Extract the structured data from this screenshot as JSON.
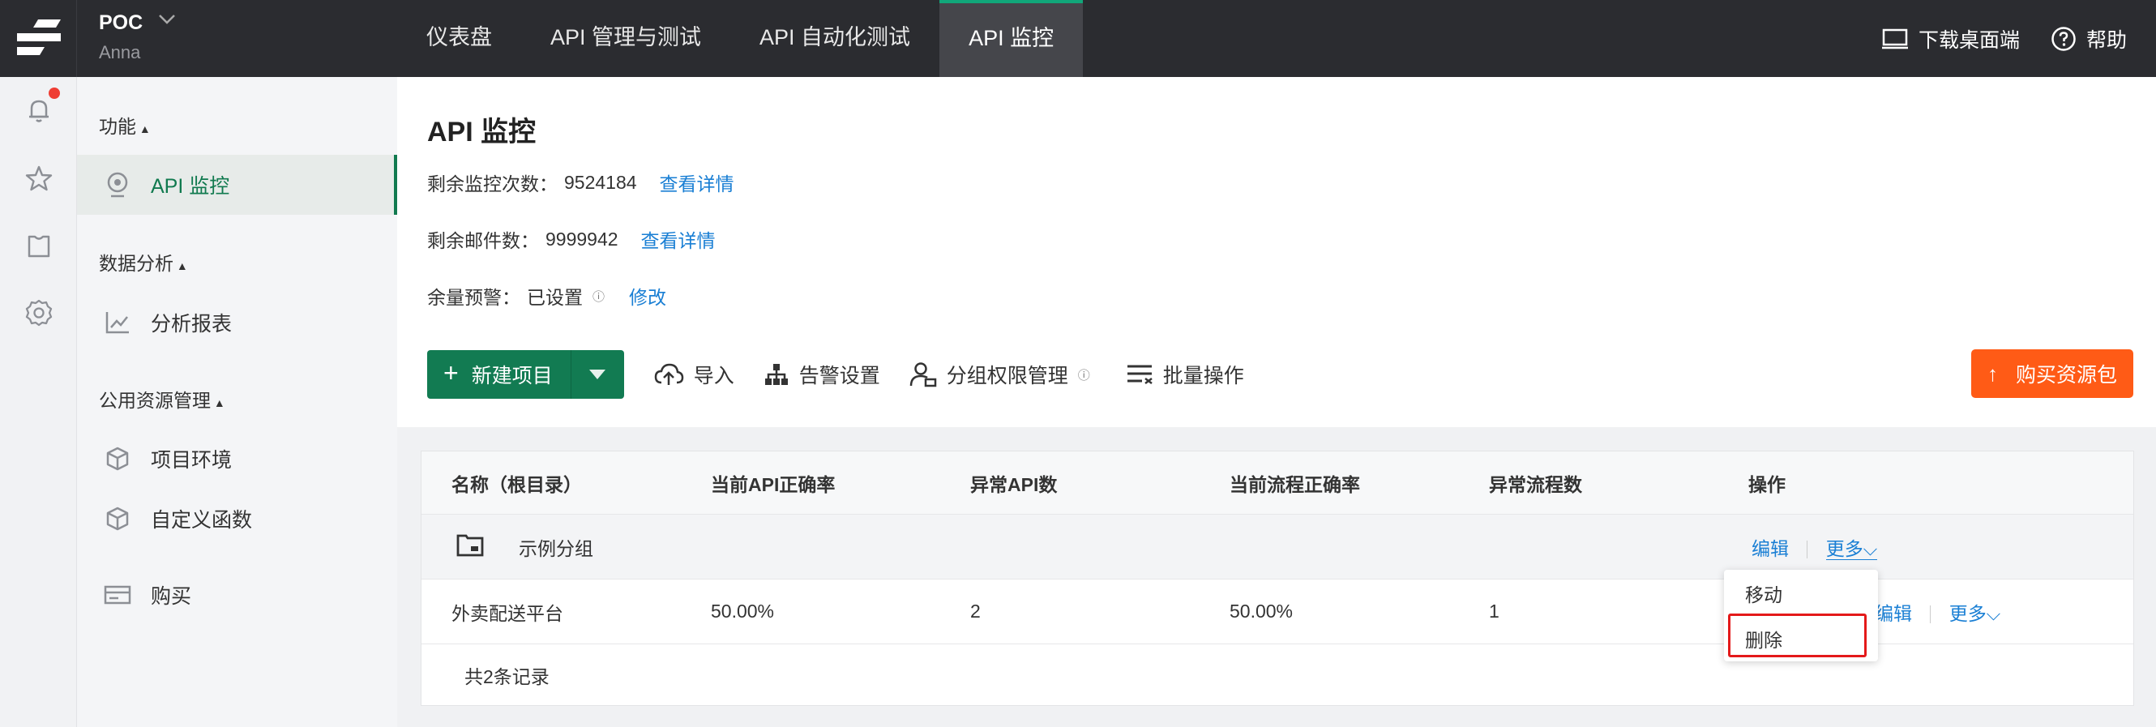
{
  "topbar": {
    "project_name": "POC",
    "user_name": "Anna",
    "nav": [
      {
        "label": "仪表盘"
      },
      {
        "label": "API 管理与测试"
      },
      {
        "label": "API 自动化测试"
      },
      {
        "label": "API 监控"
      }
    ],
    "download_label": "下载桌面端",
    "help_label": "帮助"
  },
  "sidemenu": {
    "groups": [
      {
        "title": "功能",
        "items": [
          {
            "label": "API 监控",
            "icon": "monitor-icon"
          }
        ]
      },
      {
        "title": "数据分析",
        "items": [
          {
            "label": "分析报表",
            "icon": "chart-line-icon"
          }
        ]
      },
      {
        "title": "公用资源管理",
        "items": [
          {
            "label": "项目环境",
            "icon": "cube-icon"
          },
          {
            "label": "自定义函数",
            "icon": "cube-icon"
          }
        ]
      }
    ],
    "buy_label": "购买"
  },
  "header": {
    "title": "API 监控",
    "monitor_label": "剩余监控次数：",
    "monitor_value": "9524184",
    "monitor_link": "查看详情",
    "mail_label": "剩余邮件数：",
    "mail_value": "9999942",
    "mail_link": "查看详情",
    "warn_label": "余量预警：",
    "warn_value": "已设置",
    "warn_link": "修改"
  },
  "toolbar": {
    "new_label": "新建项目",
    "import_label": "导入",
    "alert_label": "告警设置",
    "perm_label": "分组权限管理",
    "batch_label": "批量操作",
    "buy_label": "购买资源包"
  },
  "table": {
    "columns": [
      "名称（根目录）",
      "当前API正确率",
      "异常API数",
      "当前流程正确率",
      "异常流程数",
      "操作"
    ],
    "group_row": {
      "name": "示例分组",
      "edit": "编辑",
      "more": "更多"
    },
    "rows": [
      {
        "name": "外卖配送平台",
        "api_rate": "50.00%",
        "api_err": "2",
        "flow_rate": "50.00%",
        "flow_err": "1",
        "edit": "编辑",
        "more": "更多"
      }
    ],
    "footer": "共2条记录"
  },
  "dropdown": {
    "move": "移动",
    "delete": "删除"
  },
  "colors": {
    "brand_green": "#127b52",
    "accent_orange": "#ff5b16",
    "link_blue": "#1a7fd4",
    "highlight_red": "#e4191a"
  }
}
